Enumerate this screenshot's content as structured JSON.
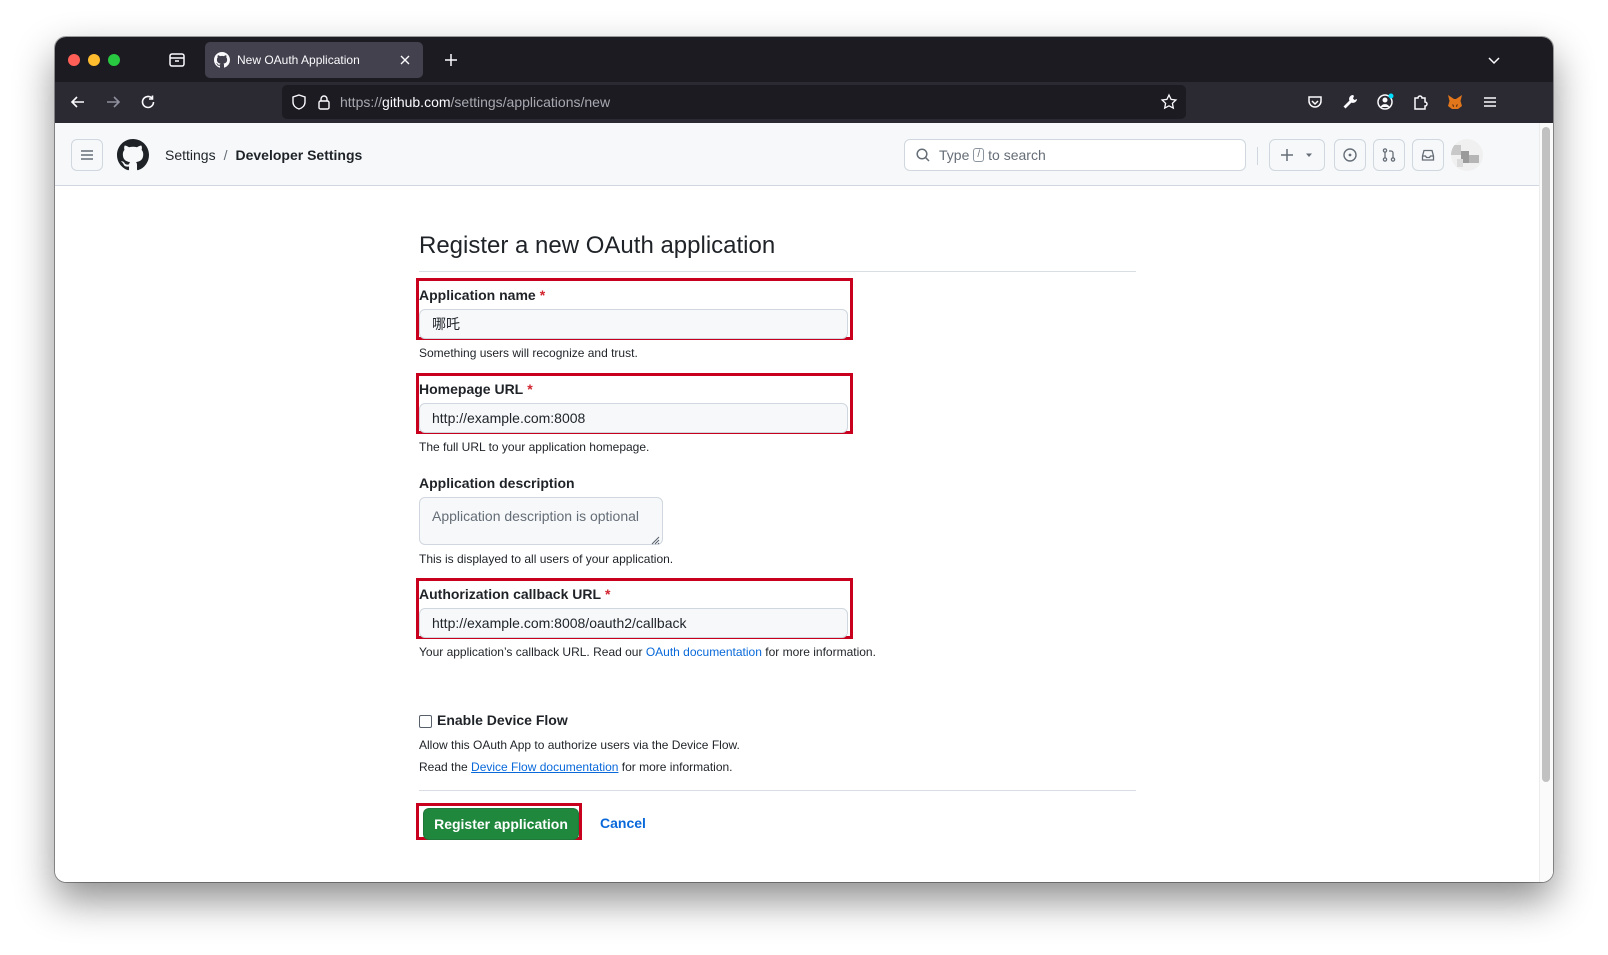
{
  "browser": {
    "tab_title": "New OAuth Application",
    "url_scheme": "https://",
    "url_host": "github.com",
    "url_path": "/settings/applications/new"
  },
  "header": {
    "crumb_settings": "Settings",
    "crumb_separator": "/",
    "crumb_developer": "Developer Settings",
    "search_prefix": "Type",
    "search_key": "/",
    "search_suffix": "to search"
  },
  "form": {
    "title": "Register a new OAuth application",
    "required_mark": "*",
    "app_name": {
      "label": "Application name",
      "value": "哪吒",
      "note": "Something users will recognize and trust."
    },
    "homepage": {
      "label": "Homepage URL",
      "value": "http://example.com:8008",
      "note": "The full URL to your application homepage."
    },
    "description": {
      "label": "Application description",
      "placeholder": "Application description is optional",
      "note": "This is displayed to all users of your application."
    },
    "callback": {
      "label": "Authorization callback URL",
      "value": "http://example.com:8008/oauth2/callback",
      "note_before": "Your application’s callback URL. Read our",
      "note_link": "OAuth documentation",
      "note_after": "for more information."
    },
    "device_flow": {
      "label": "Enable Device Flow",
      "checked": false,
      "note_line1": "Allow this OAuth App to authorize users via the Device Flow.",
      "note_line2_before": "Read the",
      "note_line2_link": "Device Flow documentation",
      "note_line2_after": "for more information."
    },
    "register_label": "Register application",
    "cancel_label": "Cancel"
  },
  "colors": {
    "primary_button": "#1f883d",
    "link": "#0969da",
    "required": "#d1242f",
    "highlight": "#c8001e"
  }
}
